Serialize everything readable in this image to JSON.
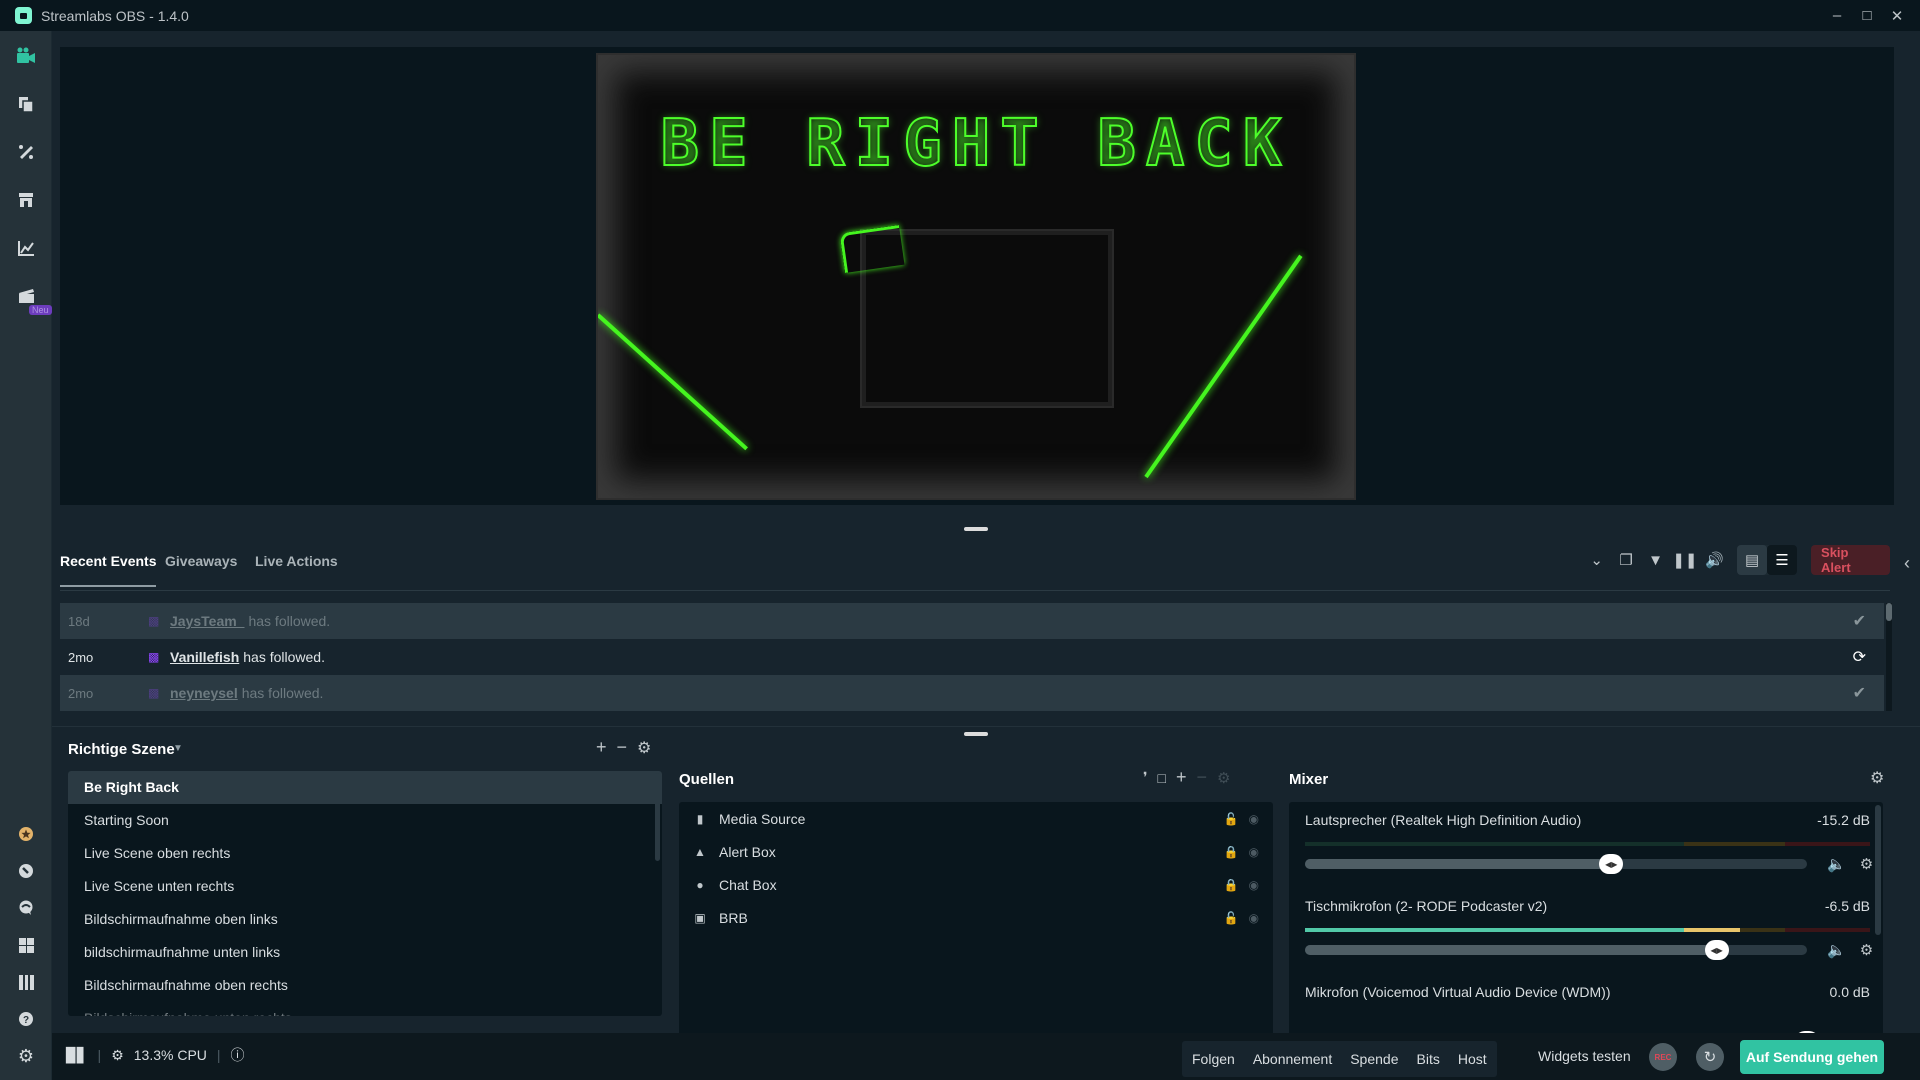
{
  "window": {
    "title": "Streamlabs OBS - 1.4.0",
    "controls": {
      "minimize": "–",
      "maximize": "□",
      "close": "✕"
    }
  },
  "sidebar": {
    "top_items": [
      {
        "name": "editor",
        "icon": "video-camera-icon",
        "glyph": "■",
        "active": true
      },
      {
        "name": "layout",
        "icon": "layout-editor-icon",
        "glyph": "❐"
      },
      {
        "name": "themes",
        "icon": "themes-icon",
        "glyph": "✦"
      },
      {
        "name": "app-store",
        "icon": "store-icon",
        "glyph": "⌂"
      },
      {
        "name": "analytics",
        "icon": "chart-icon",
        "glyph": "↗"
      },
      {
        "name": "highlighter",
        "icon": "clapper-icon",
        "glyph": "▤",
        "badge": "Neu"
      }
    ],
    "bottom_items": [
      {
        "name": "prime",
        "icon": "prime-badge-icon",
        "glyph": "★"
      },
      {
        "name": "dashboard",
        "icon": "dashboard-icon",
        "glyph": "◔"
      },
      {
        "name": "chat",
        "icon": "chat-icon",
        "glyph": "●"
      },
      {
        "name": "apps",
        "icon": "grid-icon",
        "glyph": "▦"
      },
      {
        "name": "studio-mode",
        "icon": "studio-mode-icon",
        "glyph": "‖"
      },
      {
        "name": "help",
        "icon": "help-icon",
        "glyph": "?"
      },
      {
        "name": "settings",
        "icon": "gear-icon",
        "glyph": "⚙"
      }
    ]
  },
  "preview": {
    "scene_text": "BE RIGHT BACK",
    "accent_color": "#45f51f"
  },
  "events": {
    "tabs": [
      {
        "label": "Recent Events",
        "active": true
      },
      {
        "label": "Giveaways"
      },
      {
        "label": "Live Actions"
      }
    ],
    "toolbar": {
      "skip_alert": "Skip Alert"
    },
    "rows": [
      {
        "time": "18d",
        "user": "JaysTeam_",
        "action": "has followed.",
        "state": "read"
      },
      {
        "time": "2mo",
        "user": "Vanillefish",
        "action": "has followed.",
        "state": "replaying"
      },
      {
        "time": "2mo",
        "user": "neyneysel",
        "action": "has followed.",
        "state": "read"
      }
    ]
  },
  "scenes": {
    "title": "Richtige Szene",
    "items": [
      {
        "label": "Be Right Back",
        "selected": true
      },
      {
        "label": "Starting Soon"
      },
      {
        "label": "Live Scene oben rechts"
      },
      {
        "label": "Live Scene unten rechts"
      },
      {
        "label": "Bildschirmaufnahme oben links"
      },
      {
        "label": "bildschirmaufnahme unten links"
      },
      {
        "label": "Bildschirmaufnahme oben rechts"
      },
      {
        "label": "Bildschirmaufnahme unten rechts"
      }
    ]
  },
  "sources": {
    "title": "Quellen",
    "items": [
      {
        "label": "Media Source",
        "icon": "file-icon",
        "glyph": "▤"
      },
      {
        "label": "Alert Box",
        "icon": "bell-icon",
        "glyph": "▲"
      },
      {
        "label": "Chat Box",
        "icon": "chat-bubbles-icon",
        "glyph": "●"
      },
      {
        "label": "BRB",
        "icon": "image-icon",
        "glyph": "▣"
      }
    ]
  },
  "mixer": {
    "title": "Mixer",
    "channels": [
      {
        "name": "Lautsprecher (Realtek High Definition Audio)",
        "db": "-15.2 dB",
        "volume": 0.61,
        "level": 0.0
      },
      {
        "name": "Tischmikrofon (2- RODE Podcaster v2)",
        "db": "-6.5 dB",
        "volume": 0.82,
        "level": 0.79
      },
      {
        "name": "Mikrofon (Voicemod Virtual Audio Device (WDM))",
        "db": "0.0 dB",
        "volume": 1.0,
        "level": 0.0
      }
    ]
  },
  "footer": {
    "cpu": "13.3% CPU",
    "test_buttons": [
      "Folgen",
      "Abonnement",
      "Spende",
      "Bits",
      "Host"
    ],
    "widgets_label": "Widgets testen",
    "rec_label": "REC",
    "go_live": "Auf Sendung gehen",
    "go_live_color": "#31c3a2"
  }
}
